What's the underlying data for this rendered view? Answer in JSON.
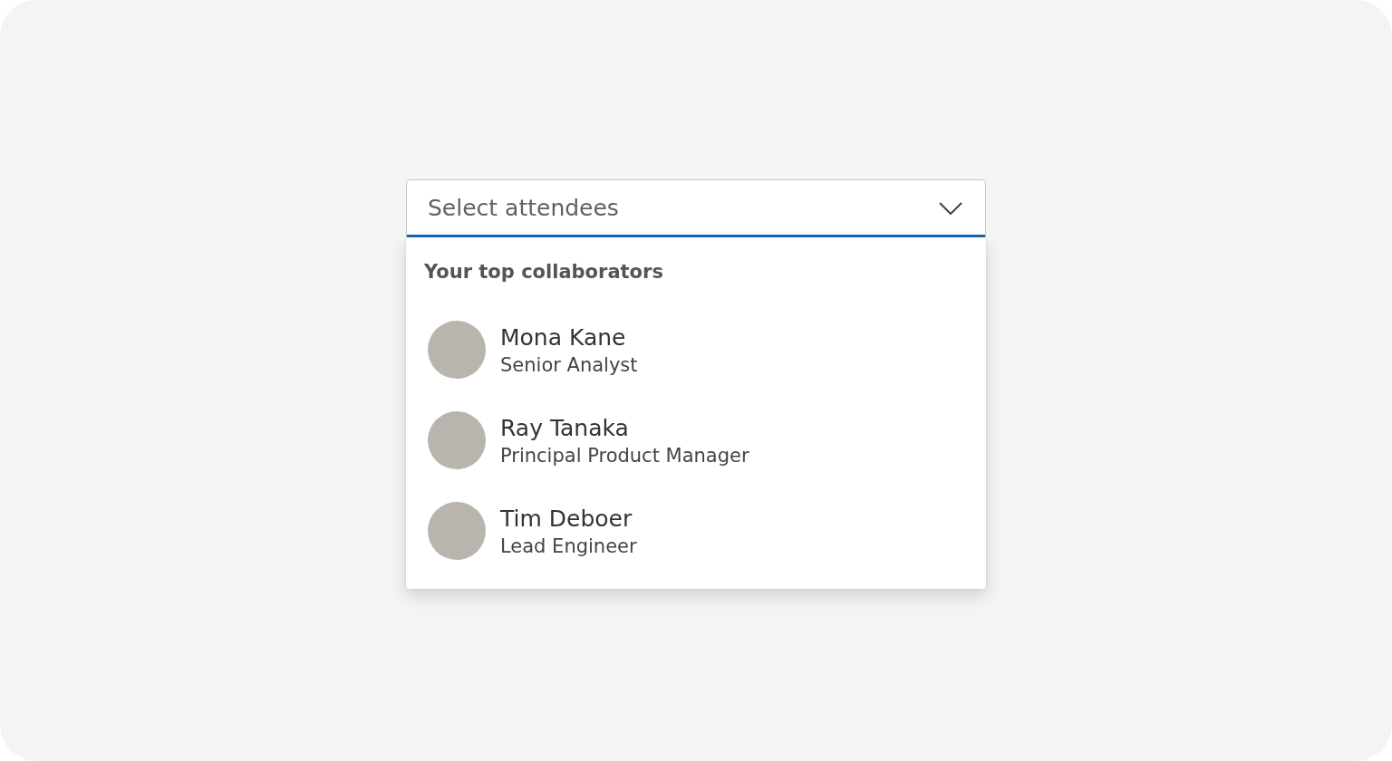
{
  "combobox": {
    "placeholder": "Select attendees",
    "expanded": true
  },
  "listbox": {
    "group_label": "Your top collaborators",
    "options": [
      {
        "name": "Mona Kane",
        "title": "Senior Analyst"
      },
      {
        "name": "Ray Tanaka",
        "title": "Principal Product Manager"
      },
      {
        "name": "Tim Deboer",
        "title": "Lead Engineer"
      }
    ]
  }
}
